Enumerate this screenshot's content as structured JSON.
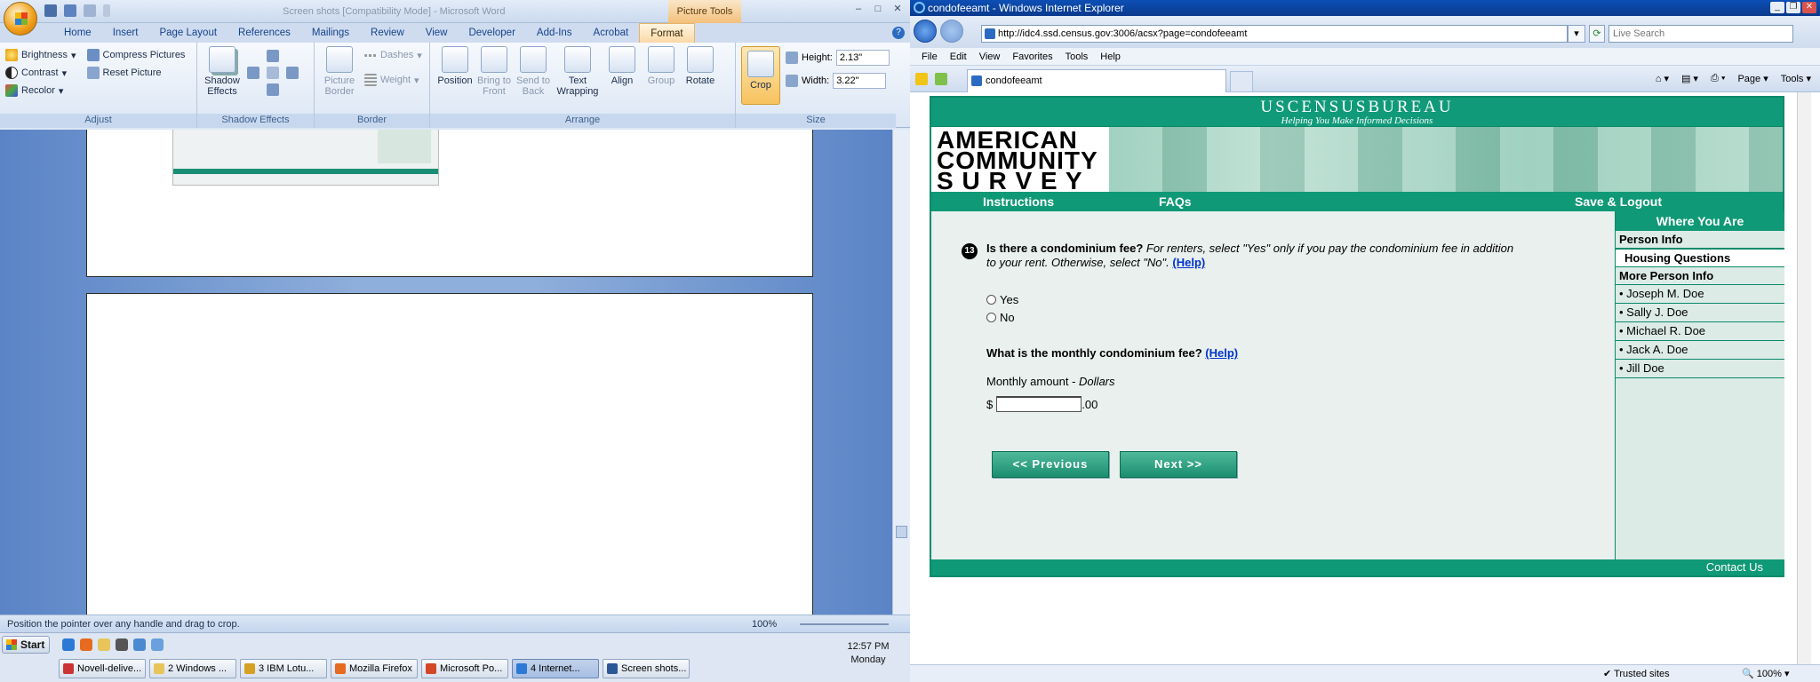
{
  "word": {
    "title": "Screen shots [Compatibility Mode] - Microsoft Word",
    "contextual_tab_group": "Picture Tools",
    "tabs": [
      "Home",
      "Insert",
      "Page Layout",
      "References",
      "Mailings",
      "Review",
      "View",
      "Developer",
      "Add-Ins",
      "Acrobat",
      "Format"
    ],
    "active_tab": "Format",
    "ribbon": {
      "adjust": {
        "label": "Adjust",
        "brightness": "Brightness",
        "contrast": "Contrast",
        "recolor": "Recolor",
        "compress": "Compress Pictures",
        "reset": "Reset Picture"
      },
      "shadow": {
        "label": "Shadow Effects",
        "shadow_effects": "Shadow Effects"
      },
      "border": {
        "label": "Border",
        "picture_border": "Picture Border",
        "dashes": "Dashes",
        "weight": "Weight"
      },
      "arrange": {
        "label": "Arrange",
        "position": "Position",
        "bring_to_front": "Bring to Front",
        "send_to_back": "Send to Back",
        "text_wrapping": "Text Wrapping",
        "align": "Align",
        "group": "Group",
        "rotate": "Rotate"
      },
      "size": {
        "label": "Size",
        "crop": "Crop",
        "height_label": "Height:",
        "height_value": "2.13\"",
        "width_label": "Width:",
        "width_value": "3.22\""
      }
    },
    "status_text": "Position the pointer over any handle and drag to crop.",
    "zoom": "100%"
  },
  "taskbar": {
    "start": "Start",
    "time": "12:57 PM",
    "day": "Monday",
    "tasks": [
      "Novell-delive...",
      "2 Windows ...",
      "3 IBM Lotu...",
      "Mozilla Firefox",
      "Microsoft Po...",
      "4 Internet...",
      "Screen shots..."
    ],
    "active_task": "4 Internet..."
  },
  "ie": {
    "title": "condofeeamt - Windows Internet Explorer",
    "url": "http://idc4.ssd.census.gov:3006/acsx?page=condofeeamt",
    "search_placeholder": "Live Search",
    "menu": [
      "File",
      "Edit",
      "View",
      "Favorites",
      "Tools",
      "Help"
    ],
    "tab_title": "condofeeamt",
    "toolbar": {
      "page": "Page",
      "tools": "Tools"
    },
    "status": {
      "zone": "Trusted sites",
      "zoom": "100%"
    }
  },
  "acs": {
    "bureau": "USCENSUSBUREAU",
    "tagline": "Helping You Make Informed Decisions",
    "wordmark": [
      "AMERICAN",
      "COMMUNITY",
      "S U R V E Y"
    ],
    "nav": {
      "instructions": "Instructions",
      "faqs": "FAQs",
      "save_logout": "Save & Logout"
    },
    "sidebar": {
      "heading": "Where You Are",
      "person_info": "Person Info",
      "current": "Housing Questions",
      "more_person_info": "More Person Info",
      "people": [
        "• Joseph M. Doe",
        "• Sally J. Doe",
        "• Michael R. Doe",
        "• Jack A. Doe",
        "• Jill Doe"
      ]
    },
    "question": {
      "number": "13",
      "bold": "Is there a condominium fee?",
      "italic": "For renters, select \"Yes\" only if you pay the condominium fee in addition to your rent. Otherwise, select \"No\".",
      "help": "(Help)",
      "options": [
        "Yes",
        "No"
      ],
      "follow_up": "What is the monthly condominium fee?",
      "amount_label": "Monthly amount - ",
      "amount_unit": "Dollars",
      "currency": "$",
      "cents": ".00",
      "amount_value": ""
    },
    "buttons": {
      "previous": "<<   Previous",
      "next": "Next   >>"
    },
    "footer": "Contact Us"
  }
}
